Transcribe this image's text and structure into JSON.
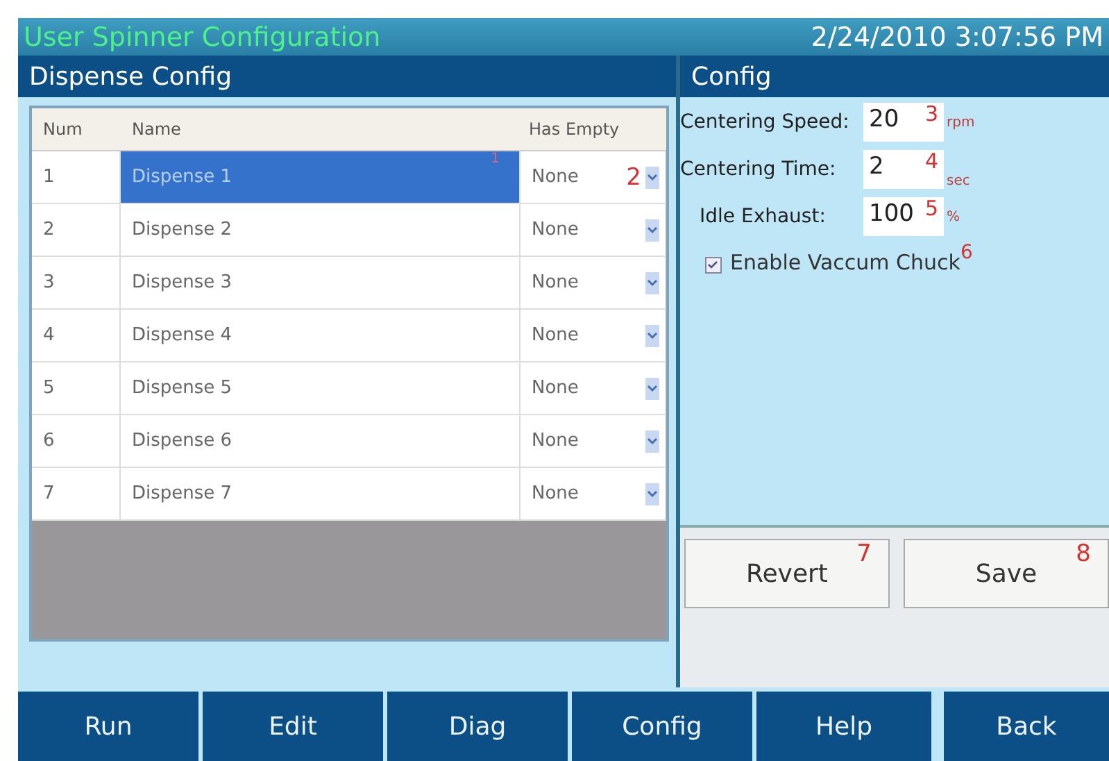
{
  "window": {
    "title": "User Spinner Configuration",
    "datetime": "2/24/2010 3:07:56 PM"
  },
  "dispense_panel": {
    "title": "Dispense Config",
    "columns": [
      "Num",
      "Name",
      "Has Empty"
    ],
    "rows": [
      {
        "num": "1",
        "name": "Dispense 1",
        "has_empty": "None",
        "selected": true,
        "name_callout": "1",
        "has_empty_callout": "2"
      },
      {
        "num": "2",
        "name": "Dispense 2",
        "has_empty": "None",
        "selected": false
      },
      {
        "num": "3",
        "name": "Dispense 3",
        "has_empty": "None",
        "selected": false
      },
      {
        "num": "4",
        "name": "Dispense 4",
        "has_empty": "None",
        "selected": false
      },
      {
        "num": "5",
        "name": "Dispense 5",
        "has_empty": "None",
        "selected": false
      },
      {
        "num": "6",
        "name": "Dispense 6",
        "has_empty": "None",
        "selected": false
      },
      {
        "num": "7",
        "name": "Dispense 7",
        "has_empty": "None",
        "selected": false
      }
    ]
  },
  "config_panel": {
    "title": "Config",
    "fields": [
      {
        "label": "Centering Speed:",
        "value": "20",
        "callout": "3",
        "unit": "rpm"
      },
      {
        "label": "Centering Time:",
        "value": "2",
        "callout": "4",
        "unit": "sec"
      },
      {
        "label": "Idle Exhaust:",
        "value": "100",
        "callout": "5",
        "unit": "%"
      }
    ],
    "checkbox": {
      "label": "Enable Vaccum Chuck",
      "checked": true,
      "callout": "6"
    },
    "buttons": [
      {
        "label": "Revert",
        "callout": "7"
      },
      {
        "label": "Save",
        "callout": "8"
      }
    ]
  },
  "nav": [
    {
      "label": "Run"
    },
    {
      "label": "Edit"
    },
    {
      "label": "Diag"
    },
    {
      "label": "Config"
    },
    {
      "label": "Help"
    },
    {
      "label": "Back"
    }
  ]
}
